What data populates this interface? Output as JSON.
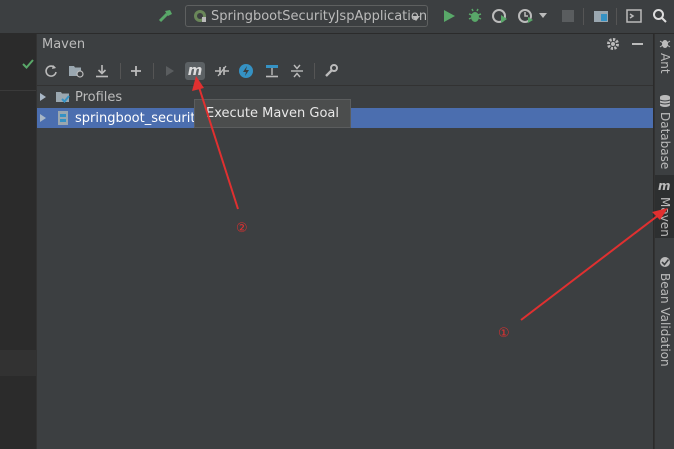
{
  "topbar": {
    "run_config": "SpringbootSecurityJspApplication",
    "icons": [
      "hammer-icon",
      "spring-config-icon",
      "chevron-down-icon",
      "run-icon",
      "debug-icon",
      "coverage-icon",
      "profile-icon",
      "stop-icon",
      "project-structure-icon",
      "terminal-icon",
      "search-icon"
    ]
  },
  "panel": {
    "title": "Maven",
    "toolbar_icons": [
      "reload-icon",
      "generate-sources-icon",
      "download-icon",
      "add-icon",
      "run-icon",
      "execute-goal-icon",
      "toggle-offline-icon",
      "skip-tests-icon",
      "show-dependencies-icon",
      "collapse-all-icon",
      "settings-wrench-icon"
    ],
    "tree": [
      {
        "label": "Profiles",
        "icon": "profiles-folder-icon",
        "selected": false
      },
      {
        "label": "springboot_security_",
        "icon": "maven-module-icon",
        "selected": true
      }
    ],
    "tooltip": "Execute Maven Goal"
  },
  "rightbar": {
    "tabs": [
      "Ant",
      "Database",
      "Maven",
      "Bean Validation"
    ],
    "active_tab": "Maven"
  },
  "annotations": {
    "one": "①",
    "two": "②"
  },
  "colors": {
    "panel_bg": "#3c3f41",
    "editor_bg": "#2b2b2b",
    "selection": "#4b6eaf",
    "annotation_red": "#e03030",
    "run_green": "#59a869"
  }
}
